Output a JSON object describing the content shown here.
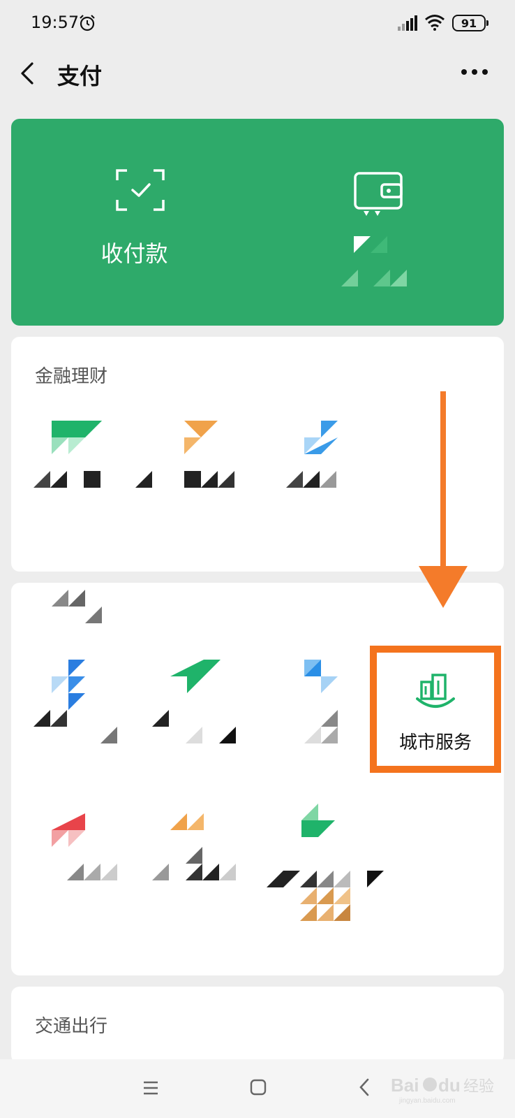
{
  "status_bar": {
    "time": "19:57",
    "battery": "91"
  },
  "nav": {
    "title": "支付"
  },
  "pay_card": {
    "left_label": "收付款",
    "right_label": ""
  },
  "sections": {
    "finance_title": "金融理财",
    "transport_title": "交通出行"
  },
  "highlight": {
    "label": "城市服务"
  },
  "colors": {
    "brand_green": "#2eaa6a",
    "highlight_orange": "#f4731d",
    "arrow_orange": "#f47b2a"
  },
  "icons": {
    "back": "back-icon",
    "more": "more-icon",
    "scan": "scan-icon",
    "wallet": "wallet-icon",
    "city": "city-building-icon"
  },
  "watermark": {
    "text": "Baidu经验",
    "sub": "jingyan.baidu.com"
  }
}
